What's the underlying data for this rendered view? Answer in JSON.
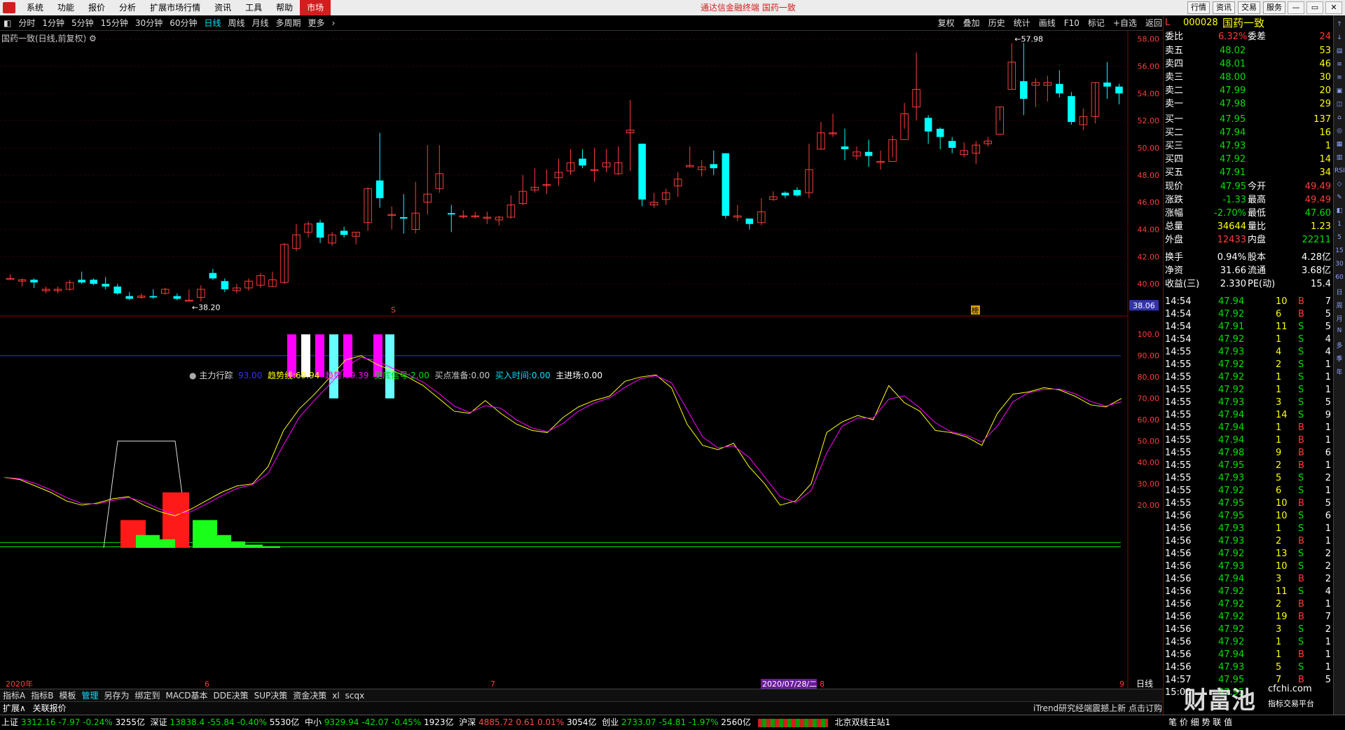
{
  "menubar": {
    "items": [
      "系统",
      "功能",
      "报价",
      "分析",
      "扩展市场行情",
      "资讯",
      "工具",
      "帮助"
    ],
    "active": "市场",
    "center_title": "通达信金融终端  国药一致",
    "right_buttons": [
      "行情",
      "资讯",
      "交易",
      "服务"
    ]
  },
  "toolbar": {
    "periods": [
      "分时",
      "1分钟",
      "5分钟",
      "15分钟",
      "30分钟",
      "60分钟",
      "日线",
      "周线",
      "月线",
      "多周期",
      "更多"
    ],
    "selected": "日线",
    "tools": [
      "复权",
      "叠加",
      "历史",
      "统计",
      "画线",
      "F10",
      "标记",
      "+自选",
      "返回"
    ]
  },
  "chart": {
    "title": "国药一致(日线,前复权)",
    "high_label": "57.98",
    "low_label": "38.20",
    "price_axis": [
      "58.00",
      "56.00",
      "54.00",
      "52.00",
      "50.00",
      "48.00",
      "46.00",
      "44.00",
      "42.00",
      "40.00"
    ],
    "current_price_marker": "38.06",
    "marker_s": "S",
    "marker_bang": "榜"
  },
  "indicator": {
    "name": "主力行踪",
    "v1": "93.00",
    "trend_line_label": "趋势线:",
    "trend_line_val": "69.94",
    "trend_label": "趋势:",
    "trend_val": "69.39",
    "bottom_signal_label": "见底信号:",
    "bottom_signal_val": "2.00",
    "buy_prep_label": "买点准备:",
    "buy_prep_val": "0.00",
    "buy_time_label": "买入时间:",
    "buy_time_val": "0.00",
    "main_label": "主进场:",
    "main_val": "0.00",
    "axis": [
      "100.0",
      "90.00",
      "80.00",
      "70.00",
      "60.00",
      "50.00",
      "40.00",
      "30.00",
      "20.00"
    ]
  },
  "xaxis": {
    "labels": [
      "2020年",
      "6",
      "7",
      "2020/07/28/二",
      "8",
      "9"
    ],
    "period": "日线"
  },
  "bottom_tabs": [
    "指标A",
    "指标B",
    "模板",
    "管理",
    "另存为",
    "绑定到",
    "MACD基本",
    "DDE决策",
    "SUP决策",
    "资金决策",
    "xl",
    "scqx"
  ],
  "bottom_tab_selected": "管理",
  "expand": {
    "left": "扩展∧",
    "link": "关联报价",
    "news": "iTrend研究经端震撼上新 点击订购"
  },
  "quote": {
    "code": "000028",
    "name": "国药一致",
    "ratio_label": "委比",
    "ratio": "6.32%",
    "diff_label": "委差",
    "diff": "24",
    "asks": [
      {
        "label": "卖五",
        "price": "48.02",
        "vol": "53"
      },
      {
        "label": "卖四",
        "price": "48.01",
        "vol": "46"
      },
      {
        "label": "卖三",
        "price": "48.00",
        "vol": "30"
      },
      {
        "label": "卖二",
        "price": "47.99",
        "vol": "20"
      },
      {
        "label": "卖一",
        "price": "47.98",
        "vol": "29"
      }
    ],
    "bids": [
      {
        "label": "买一",
        "price": "47.95",
        "vol": "137"
      },
      {
        "label": "买二",
        "price": "47.94",
        "vol": "16"
      },
      {
        "label": "买三",
        "price": "47.93",
        "vol": "1"
      },
      {
        "label": "买四",
        "price": "47.92",
        "vol": "14"
      },
      {
        "label": "买五",
        "price": "47.91",
        "vol": "34"
      }
    ],
    "stats": [
      {
        "l1": "现价",
        "v1": "47.95",
        "c1": "green",
        "l2": "今开",
        "v2": "49.49",
        "c2": "red"
      },
      {
        "l1": "涨跌",
        "v1": "-1.33",
        "c1": "green",
        "l2": "最高",
        "v2": "49.49",
        "c2": "red"
      },
      {
        "l1": "涨幅",
        "v1": "-2.70%",
        "c1": "green",
        "l2": "最低",
        "v2": "47.60",
        "c2": "green"
      },
      {
        "l1": "总量",
        "v1": "34644",
        "c1": "yellow",
        "l2": "量比",
        "v2": "1.23",
        "c2": "yellow"
      },
      {
        "l1": "外盘",
        "v1": "12433",
        "c1": "red",
        "l2": "内盘",
        "v2": "22211",
        "c2": "green"
      },
      {
        "l1": "换手",
        "v1": "0.94%",
        "c1": "white",
        "l2": "股本",
        "v2": "4.28亿",
        "c2": "white"
      },
      {
        "l1": "净资",
        "v1": "31.66",
        "c1": "white",
        "l2": "流通",
        "v2": "3.68亿",
        "c2": "white"
      },
      {
        "l1": "收益(三)",
        "v1": "2.330",
        "c1": "white",
        "l2": "PE(动)",
        "v2": "15.4",
        "c2": "white"
      }
    ],
    "ticks": [
      [
        "14:54",
        "47.94",
        "10",
        "B",
        "7"
      ],
      [
        "14:54",
        "47.92",
        "6",
        "B",
        "5"
      ],
      [
        "14:54",
        "47.91",
        "11",
        "S",
        "5"
      ],
      [
        "14:54",
        "47.92",
        "1",
        "S",
        "4"
      ],
      [
        "14:55",
        "47.93",
        "4",
        "S",
        "4"
      ],
      [
        "14:55",
        "47.92",
        "2",
        "S",
        "1"
      ],
      [
        "14:55",
        "47.92",
        "1",
        "S",
        "1"
      ],
      [
        "14:55",
        "47.92",
        "1",
        "S",
        "1"
      ],
      [
        "14:55",
        "47.93",
        "3",
        "S",
        "5"
      ],
      [
        "14:55",
        "47.94",
        "14",
        "S",
        "9"
      ],
      [
        "14:55",
        "47.94",
        "1",
        "B",
        "1"
      ],
      [
        "14:55",
        "47.94",
        "1",
        "B",
        "1"
      ],
      [
        "14:55",
        "47.98",
        "9",
        "B",
        "6"
      ],
      [
        "14:55",
        "47.95",
        "2",
        "B",
        "1"
      ],
      [
        "14:55",
        "47.93",
        "5",
        "S",
        "2"
      ],
      [
        "14:55",
        "47.92",
        "6",
        "S",
        "1"
      ],
      [
        "14:55",
        "47.95",
        "10",
        "B",
        "5"
      ],
      [
        "14:56",
        "47.95",
        "10",
        "S",
        "6"
      ],
      [
        "14:56",
        "47.93",
        "1",
        "S",
        "1"
      ],
      [
        "14:56",
        "47.93",
        "2",
        "B",
        "1"
      ],
      [
        "14:56",
        "47.92",
        "13",
        "S",
        "2"
      ],
      [
        "14:56",
        "47.93",
        "10",
        "S",
        "2"
      ],
      [
        "14:56",
        "47.94",
        "3",
        "B",
        "2"
      ],
      [
        "14:56",
        "47.92",
        "11",
        "S",
        "4"
      ],
      [
        "14:56",
        "47.92",
        "2",
        "B",
        "1"
      ],
      [
        "14:56",
        "47.92",
        "19",
        "B",
        "7"
      ],
      [
        "14:56",
        "47.92",
        "3",
        "S",
        "2"
      ],
      [
        "14:56",
        "47.92",
        "1",
        "S",
        "1"
      ],
      [
        "14:56",
        "47.94",
        "1",
        "B",
        "1"
      ],
      [
        "14:56",
        "47.93",
        "5",
        "S",
        "1"
      ],
      [
        "14:57",
        "47.95",
        "7",
        "B",
        "5"
      ],
      [
        "15:00",
        "47.95",
        "",
        "",
        ""
      ]
    ]
  },
  "sidebar_icons": [
    "↑",
    "↓",
    "▤",
    "≡",
    "≡",
    "▣",
    "◫",
    "⌂",
    "◎",
    "▦",
    "▥",
    "RSI",
    "◇",
    "✎",
    "◧",
    "1",
    "5",
    "15",
    "30",
    "60",
    "日",
    "周",
    "月",
    "N",
    "多",
    "季",
    "年"
  ],
  "watermark": {
    "name": "财富池",
    "site": "cfchi.com",
    "sub": "指标交易平台"
  },
  "status": {
    "sh_label": "上证",
    "sh": "3312.16",
    "sh_chg": "-7.97",
    "sh_pct": "-0.24%",
    "sh_amt": "3255亿",
    "sz_label": "深证",
    "sz": "13838.4",
    "sz_chg": "-55.84",
    "sz_pct": "-0.40%",
    "sz_amt": "5530亿",
    "zx_label": "中小",
    "zx": "9329.94",
    "zx_chg": "-42.07",
    "zx_pct": "-0.45%",
    "zx_amt": "1923亿",
    "hs_label": "沪深",
    "hs": "4885.72",
    "hs_chg": "0.61",
    "hs_pct": "0.01%",
    "hs_amt": "3054亿",
    "cy_label": "创业",
    "cy": "2733.07",
    "cy_chg": "-54.81",
    "cy_pct": "-1.97%",
    "cy_amt": "2560亿",
    "server": "北京双线主站1",
    "right": "笔 价 细 势 联 值"
  },
  "chart_data": {
    "type": "candlestick",
    "candles": [
      [
        40.4,
        40.4,
        40.7,
        40.3
      ],
      [
        40.2,
        40.3,
        40.4,
        39.8
      ],
      [
        40.3,
        40.1,
        40.4,
        39.7
      ],
      [
        39.5,
        39.6,
        39.8,
        39.3
      ],
      [
        39.5,
        39.6,
        39.8,
        39.3
      ],
      [
        39.6,
        40.1,
        40.3,
        39.5
      ],
      [
        40.3,
        40.1,
        40.9,
        40.0
      ],
      [
        40.3,
        40.0,
        40.4,
        39.9
      ],
      [
        40.0,
        39.8,
        40.5,
        39.6
      ],
      [
        39.8,
        39.3,
        40.0,
        39.2
      ],
      [
        39.1,
        38.9,
        39.4,
        38.8
      ],
      [
        39.0,
        39.1,
        39.3,
        38.9
      ],
      [
        39.1,
        39.0,
        39.6,
        38.9
      ],
      [
        39.3,
        39.6,
        39.7,
        39.2
      ],
      [
        39.1,
        38.9,
        39.3,
        38.8
      ],
      [
        38.8,
        38.8,
        39.6,
        38.7
      ],
      [
        39.0,
        39.6,
        39.9,
        38.7
      ],
      [
        40.8,
        40.4,
        41.1,
        40.3
      ],
      [
        40.2,
        39.6,
        40.4,
        39.4
      ],
      [
        39.5,
        39.7,
        40.0,
        39.3
      ],
      [
        39.7,
        40.2,
        40.4,
        39.5
      ],
      [
        39.9,
        40.6,
        40.8,
        39.7
      ],
      [
        39.8,
        40.3,
        40.9,
        39.8
      ],
      [
        40.1,
        42.9,
        43.0,
        40.0
      ],
      [
        42.6,
        43.6,
        44.4,
        42.4
      ],
      [
        43.8,
        44.4,
        44.6,
        43.4
      ],
      [
        44.5,
        43.4,
        44.7,
        43.0
      ],
      [
        43.0,
        43.6,
        43.8,
        42.8
      ],
      [
        43.9,
        43.6,
        44.2,
        43.4
      ],
      [
        43.5,
        43.8,
        43.8,
        42.9
      ],
      [
        44.5,
        47.0,
        47.1,
        43.9
      ],
      [
        47.6,
        46.3,
        51.1,
        45.6
      ],
      [
        45.1,
        45.1,
        45.7,
        44.0
      ],
      [
        44.9,
        44.8,
        46.6,
        43.7
      ],
      [
        44.0,
        45.2,
        47.5,
        43.7
      ],
      [
        46.0,
        46.6,
        50.2,
        45.1
      ],
      [
        47.0,
        48.1,
        50.2,
        46.7
      ],
      [
        45.2,
        45.1,
        45.8,
        43.8
      ],
      [
        45.0,
        45.0,
        45.4,
        44.8
      ],
      [
        45.0,
        45.0,
        45.3,
        44.8
      ],
      [
        44.9,
        44.9,
        45.3,
        44.4
      ],
      [
        44.7,
        44.9,
        45.0,
        44.3
      ],
      [
        44.9,
        45.8,
        46.5,
        44.8
      ],
      [
        45.9,
        46.8,
        48.0,
        45.8
      ],
      [
        46.9,
        47.1,
        48.5,
        46.7
      ],
      [
        47.3,
        47.3,
        48.4,
        46.6
      ],
      [
        47.8,
        48.2,
        49.2,
        47.2
      ],
      [
        48.3,
        48.9,
        49.9,
        48.0
      ],
      [
        49.2,
        48.7,
        49.9,
        48.5
      ],
      [
        48.4,
        48.4,
        50.0,
        47.5
      ],
      [
        48.6,
        48.9,
        49.9,
        48.2
      ],
      [
        48.1,
        48.9,
        50.1,
        48.0
      ],
      [
        51.1,
        51.3,
        53.5,
        48.3
      ],
      [
        50.3,
        46.2,
        50.3,
        45.7
      ],
      [
        45.8,
        46.0,
        46.7,
        45.6
      ],
      [
        46.2,
        46.7,
        47.0,
        45.8
      ],
      [
        47.2,
        47.7,
        48.2,
        46.4
      ],
      [
        48.6,
        48.7,
        50.1,
        48.6
      ],
      [
        48.4,
        48.6,
        49.1,
        47.9
      ],
      [
        48.8,
        48.5,
        49.8,
        48.0
      ],
      [
        49.6,
        45.0,
        49.6,
        44.8
      ],
      [
        44.9,
        45.0,
        45.8,
        44.6
      ],
      [
        44.8,
        44.4,
        44.6,
        44.0
      ],
      [
        44.5,
        45.3,
        46.3,
        44.3
      ],
      [
        46.2,
        46.4,
        46.8,
        46.1
      ],
      [
        46.7,
        46.5,
        46.8,
        46.3
      ],
      [
        46.9,
        46.5,
        47.1,
        46.4
      ],
      [
        46.7,
        48.4,
        50.3,
        46.3
      ],
      [
        49.9,
        51.1,
        51.9,
        49.9
      ],
      [
        51.1,
        51.1,
        52.5,
        50.8
      ],
      [
        50.1,
        49.9,
        51.4,
        49.1
      ],
      [
        49.4,
        49.7,
        50.1,
        49.1
      ],
      [
        49.7,
        49.4,
        50.6,
        48.6
      ],
      [
        49.0,
        49.0,
        49.8,
        48.4
      ],
      [
        49.0,
        50.6,
        50.9,
        49.3
      ],
      [
        50.6,
        52.5,
        53.3,
        51.4
      ],
      [
        53.0,
        54.3,
        57.0,
        52.0
      ],
      [
        52.2,
        51.2,
        52.4,
        50.3
      ],
      [
        51.4,
        50.8,
        51.5,
        49.9
      ],
      [
        50.5,
        50.0,
        50.8,
        49.6
      ],
      [
        49.5,
        49.8,
        50.4,
        49.3
      ],
      [
        49.6,
        50.2,
        50.5,
        48.8
      ],
      [
        50.3,
        50.5,
        50.8,
        50.1
      ],
      [
        51.0,
        53.0,
        53.0,
        52.0
      ],
      [
        54.3,
        56.3,
        57.7,
        54.3
      ],
      [
        54.9,
        53.6,
        57.7,
        52.4
      ],
      [
        54.6,
        54.8,
        55.1,
        53.0
      ],
      [
        54.6,
        54.8,
        55.3,
        53.4
      ],
      [
        54.7,
        54.0,
        55.7,
        53.7
      ],
      [
        53.8,
        51.9,
        54.1,
        51.7
      ],
      [
        51.7,
        52.3,
        52.9,
        51.3
      ],
      [
        52.3,
        54.8,
        54.8,
        51.8
      ],
      [
        54.8,
        54.5,
        56.3,
        53.6
      ],
      [
        54.5,
        54.0,
        54.7,
        53.2
      ]
    ],
    "indicator_series": {
      "trend_line": [
        33,
        32,
        29,
        26,
        22,
        20,
        21,
        23,
        24,
        20,
        17,
        15,
        18,
        22,
        26,
        29,
        30,
        38,
        55,
        65,
        72,
        80,
        88,
        90,
        86,
        83,
        80,
        76,
        70,
        64,
        63,
        69,
        63,
        58,
        55,
        54,
        61,
        66,
        69,
        71,
        78,
        80,
        81,
        75,
        58,
        48,
        46,
        49,
        38,
        30,
        20,
        22,
        30,
        54,
        59,
        62,
        60,
        76,
        68,
        64,
        55,
        54,
        52,
        48,
        63,
        72,
        73,
        75,
        74,
        71,
        67,
        66,
        70
      ]
    }
  }
}
